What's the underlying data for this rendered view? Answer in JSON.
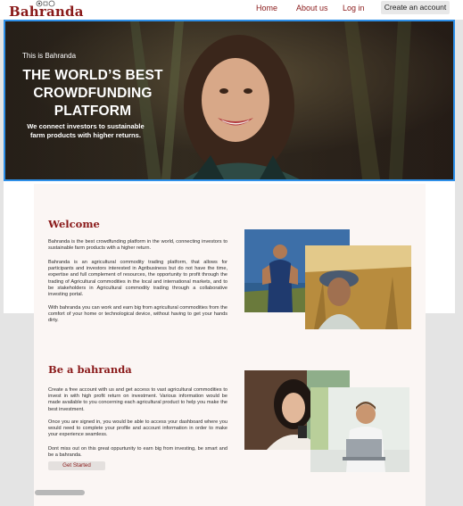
{
  "nav": {
    "logo_text": "Bahranda",
    "links": [
      "Home",
      "About us",
      "Log in"
    ],
    "cta": "Create an account"
  },
  "hero": {
    "eyebrow": "This is Bahranda",
    "title": "THE WORLD’S BEST CROWDFUNDING PLATFORM",
    "subtitle": "We connect investors to sustainable farm products with higher returns."
  },
  "welcome": {
    "title": "Welcome",
    "paragraphs": [
      "Bahranda is the best crowdfunding platform in the world, connecting investors to sustainable farm products with a higher return.",
      "Bahranda is an agricultural commodity trading platform, that allows for participants and investors interested in Agribusiness but do not have the time, expertise and full complement of resources, the opportunity to profit through the trading of Agricultural commodities in the local and international markets, and to be stakeholders in Agricultural commodity trading through a collaborative investing portal.",
      "With bahranda you can work and earn big from agricultural commodities from the comfort of your home or technological device, without having to get your hands dirty."
    ]
  },
  "be": {
    "title": "Be a bahranda",
    "paragraphs": [
      "Create a free account with us and get access to vast agricultural commodities to invest in with high profit return on investment. Various information would be made available to you concerning each agricultural product to help you make the best investment.",
      "Once you are signed in, you would be able to access your dashboard where you would need to complete your profile and account information in order to make your experience seamless.",
      "Dont miss out on this great oppurtunity to earn big from investing, be smart and be a bahranda."
    ],
    "button": "Get Started"
  },
  "colors": {
    "brand": "#8a1a1a",
    "hero_border": "#2d8fe8",
    "card_bg": "#fbf6f4"
  }
}
